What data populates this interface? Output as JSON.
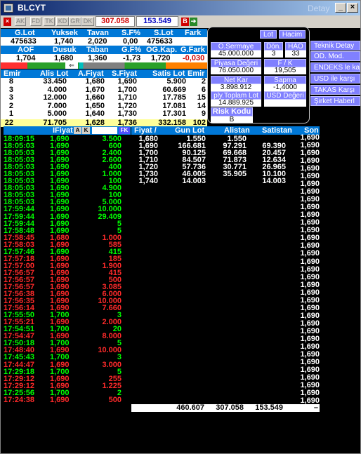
{
  "window": {
    "title": "BLCYT",
    "detail_label": "Detay"
  },
  "toolbar": {
    "buttons": [
      "AK",
      "FD",
      "TK",
      "KD",
      "GR",
      "DK"
    ],
    "last_price": "307.058",
    "last_volume": "153.549",
    "b_label": "B"
  },
  "summary": {
    "row1_headers": [
      "G.Lot",
      "Yuksek",
      "Tavan",
      "S.F%",
      "S.Lot",
      "Fark"
    ],
    "row1_values": [
      "475633",
      "1,740",
      "2,020",
      "0,00",
      "475633",
      ""
    ],
    "row2_headers": [
      "AOF",
      "Dusuk",
      "Taban",
      "G.F%",
      "OG.Kap.",
      "G.Fark"
    ],
    "row2_values": [
      "1,704",
      "1,680",
      "1,360",
      "-1,73",
      "1,720",
      "-0,030"
    ]
  },
  "depth": {
    "headers": [
      "Emir",
      "Alis Lot",
      "A.Fiyat",
      "S.Fiyat",
      "Satis Lot",
      "Emir"
    ],
    "rows": [
      [
        "8",
        "33.450",
        "1,680",
        "1,690",
        "5.900",
        "2"
      ],
      [
        "3",
        "4.000",
        "1,670",
        "1,700",
        "60.669",
        "6"
      ],
      [
        "3",
        "12.000",
        "1,660",
        "1,710",
        "17.785",
        "15"
      ],
      [
        "2",
        "7.000",
        "1,650",
        "1,720",
        "17.081",
        "14"
      ],
      [
        "1",
        "5.000",
        "1,640",
        "1,730",
        "17.301",
        "9"
      ]
    ],
    "totals": [
      "22",
      "71.705",
      "1,628",
      "1,736",
      "332.158",
      "102"
    ]
  },
  "info_panel": {
    "lot_label": "Lot",
    "hacim_label": "Hacim",
    "o_sermaye_label": "O.Sermaye",
    "o_sermaye_value": "45.000.000",
    "don_label": "Dön.",
    "don_value": "3",
    "hao_label": "HAO",
    "hao_value": "33",
    "piyasa_label": "Piyasa Değeri",
    "piyasa_value": "76.050.000",
    "fk_label": "F / K",
    "fk_value": "19,505",
    "net_kar_label": "Net Kar",
    "net_kar_value": "3.898.912",
    "sapma_label": "Sapma",
    "sapma_value": "-1,4000",
    "ply_toplam_label": "ply.Toplam Lot",
    "ply_toplam_value": "14.889.925",
    "usd_degeri_label": "USD Değeri",
    "risk_kodu_label": "Risk Kodu",
    "risk_kodu_value": "B"
  },
  "right_buttons": [
    "Teknik Detay",
    "OD. Mod.",
    "ENDEKS le karş",
    "USD ile karşı",
    "TAKAS Karşı",
    "Şirket Haberl"
  ],
  "trades_header": {
    "fiyat": "IFiyat",
    "a": "A",
    "k": "K",
    "fk": "FK"
  },
  "book_headers": [
    "Fiyat /",
    "Gun Lot",
    "Alistan",
    "Satistan",
    "Son"
  ],
  "trades": [
    {
      "time": "18:09:15",
      "price": "1,690",
      "lot": "3.500",
      "side": "g"
    },
    {
      "time": "18:05:03",
      "price": "1,690",
      "lot": "600",
      "side": "g"
    },
    {
      "time": "18:05:03",
      "price": "1,690",
      "lot": "2.400",
      "side": "g"
    },
    {
      "time": "18:05:03",
      "price": "1,690",
      "lot": "2.600",
      "side": "g"
    },
    {
      "time": "18:05:03",
      "price": "1,690",
      "lot": "400",
      "side": "g"
    },
    {
      "time": "18:05:03",
      "price": "1,690",
      "lot": "1.000",
      "side": "g"
    },
    {
      "time": "18:05:03",
      "price": "1,690",
      "lot": "100",
      "side": "g"
    },
    {
      "time": "18:05:03",
      "price": "1,690",
      "lot": "4.900",
      "side": "g"
    },
    {
      "time": "18:05:03",
      "price": "1,690",
      "lot": "100",
      "side": "g"
    },
    {
      "time": "18:05:03",
      "price": "1,690",
      "lot": "5.000",
      "side": "g"
    },
    {
      "time": "17:59:44",
      "price": "1,690",
      "lot": "10.000",
      "side": "g"
    },
    {
      "time": "17:59:44",
      "price": "1,690",
      "lot": "29.409",
      "side": "g"
    },
    {
      "time": "17:59:44",
      "price": "1,690",
      "lot": "5",
      "side": "g"
    },
    {
      "time": "17:58:48",
      "price": "1,690",
      "lot": "5",
      "side": "g"
    },
    {
      "time": "17:58:45",
      "price": "1,680",
      "lot": "1.000",
      "side": "r"
    },
    {
      "time": "17:58:03",
      "price": "1,690",
      "lot": "585",
      "side": "r"
    },
    {
      "time": "17:57:46",
      "price": "1,690",
      "lot": "415",
      "side": "g"
    },
    {
      "time": "17:57:18",
      "price": "1,690",
      "lot": "185",
      "side": "r"
    },
    {
      "time": "17:57:00",
      "price": "1,690",
      "lot": "1.900",
      "side": "r"
    },
    {
      "time": "17:56:57",
      "price": "1,690",
      "lot": "415",
      "side": "r"
    },
    {
      "time": "17:56:57",
      "price": "1,690",
      "lot": "500",
      "side": "r"
    },
    {
      "time": "17:56:57",
      "price": "1,690",
      "lot": "3.085",
      "side": "r"
    },
    {
      "time": "17:56:38",
      "price": "1,690",
      "lot": "6.000",
      "side": "r"
    },
    {
      "time": "17:56:35",
      "price": "1,690",
      "lot": "10.000",
      "side": "r"
    },
    {
      "time": "17:56:14",
      "price": "1,690",
      "lot": "7.660",
      "side": "r"
    },
    {
      "time": "17:55:50",
      "price": "1,700",
      "lot": "3",
      "side": "g"
    },
    {
      "time": "17:55:21",
      "price": "1,690",
      "lot": "2.000",
      "side": "r"
    },
    {
      "time": "17:54:51",
      "price": "1,700",
      "lot": "20",
      "side": "g"
    },
    {
      "time": "17:54:47",
      "price": "1,690",
      "lot": "8.000",
      "side": "r"
    },
    {
      "time": "17:50:18",
      "price": "1,700",
      "lot": "5",
      "side": "g"
    },
    {
      "time": "17:48:40",
      "price": "1,690",
      "lot": "10.000",
      "side": "r"
    },
    {
      "time": "17:45:43",
      "price": "1,700",
      "lot": "3",
      "side": "g"
    },
    {
      "time": "17:44:47",
      "price": "1,690",
      "lot": "3.000",
      "side": "r"
    },
    {
      "time": "17:29:18",
      "price": "1,700",
      "lot": "5",
      "side": "g"
    },
    {
      "time": "17:29:12",
      "price": "1,690",
      "lot": "255",
      "side": "r"
    },
    {
      "time": "17:29:12",
      "price": "1,690",
      "lot": "1.225",
      "side": "r"
    },
    {
      "time": "17:25:56",
      "price": "1,700",
      "lot": "2",
      "side": "g"
    },
    {
      "time": "17:24:38",
      "price": "1,690",
      "lot": "500",
      "side": "r"
    }
  ],
  "book": [
    [
      "1,680",
      "1.550",
      "1.550",
      ""
    ],
    [
      "1,690",
      "166.681",
      "97.291",
      "69.390"
    ],
    [
      "1,700",
      "90.125",
      "69.668",
      "20.457"
    ],
    [
      "1,710",
      "84.507",
      "71.873",
      "12.634"
    ],
    [
      "1,720",
      "57.736",
      "30.771",
      "26.965"
    ],
    [
      "1,730",
      "46.005",
      "35.905",
      "10.100"
    ],
    [
      "1,740",
      "14.003",
      "",
      "14.003"
    ]
  ],
  "son_values": [
    "1,690",
    "1,690",
    "1,690",
    "1,690",
    "1,690",
    "1,690",
    "1,690",
    "1,690",
    "1,690",
    "1,690",
    "1,690",
    "1,690",
    "1,690",
    "1,690",
    "1,690",
    "1,690",
    "1,690",
    "1,690",
    "1,690",
    "1,690",
    "1,690",
    "1,690",
    "1,690",
    "1,690",
    "1,690",
    "1,690",
    "1,690",
    "1,690",
    "1,690",
    "1,690",
    "1,690",
    "1,690",
    "1,690",
    "1,690",
    "1,690",
    "1,690"
  ],
  "totals_row": {
    "gun_lot": "460.607",
    "alistan": "307.058",
    "satistan": "153.549",
    "son": "–"
  }
}
